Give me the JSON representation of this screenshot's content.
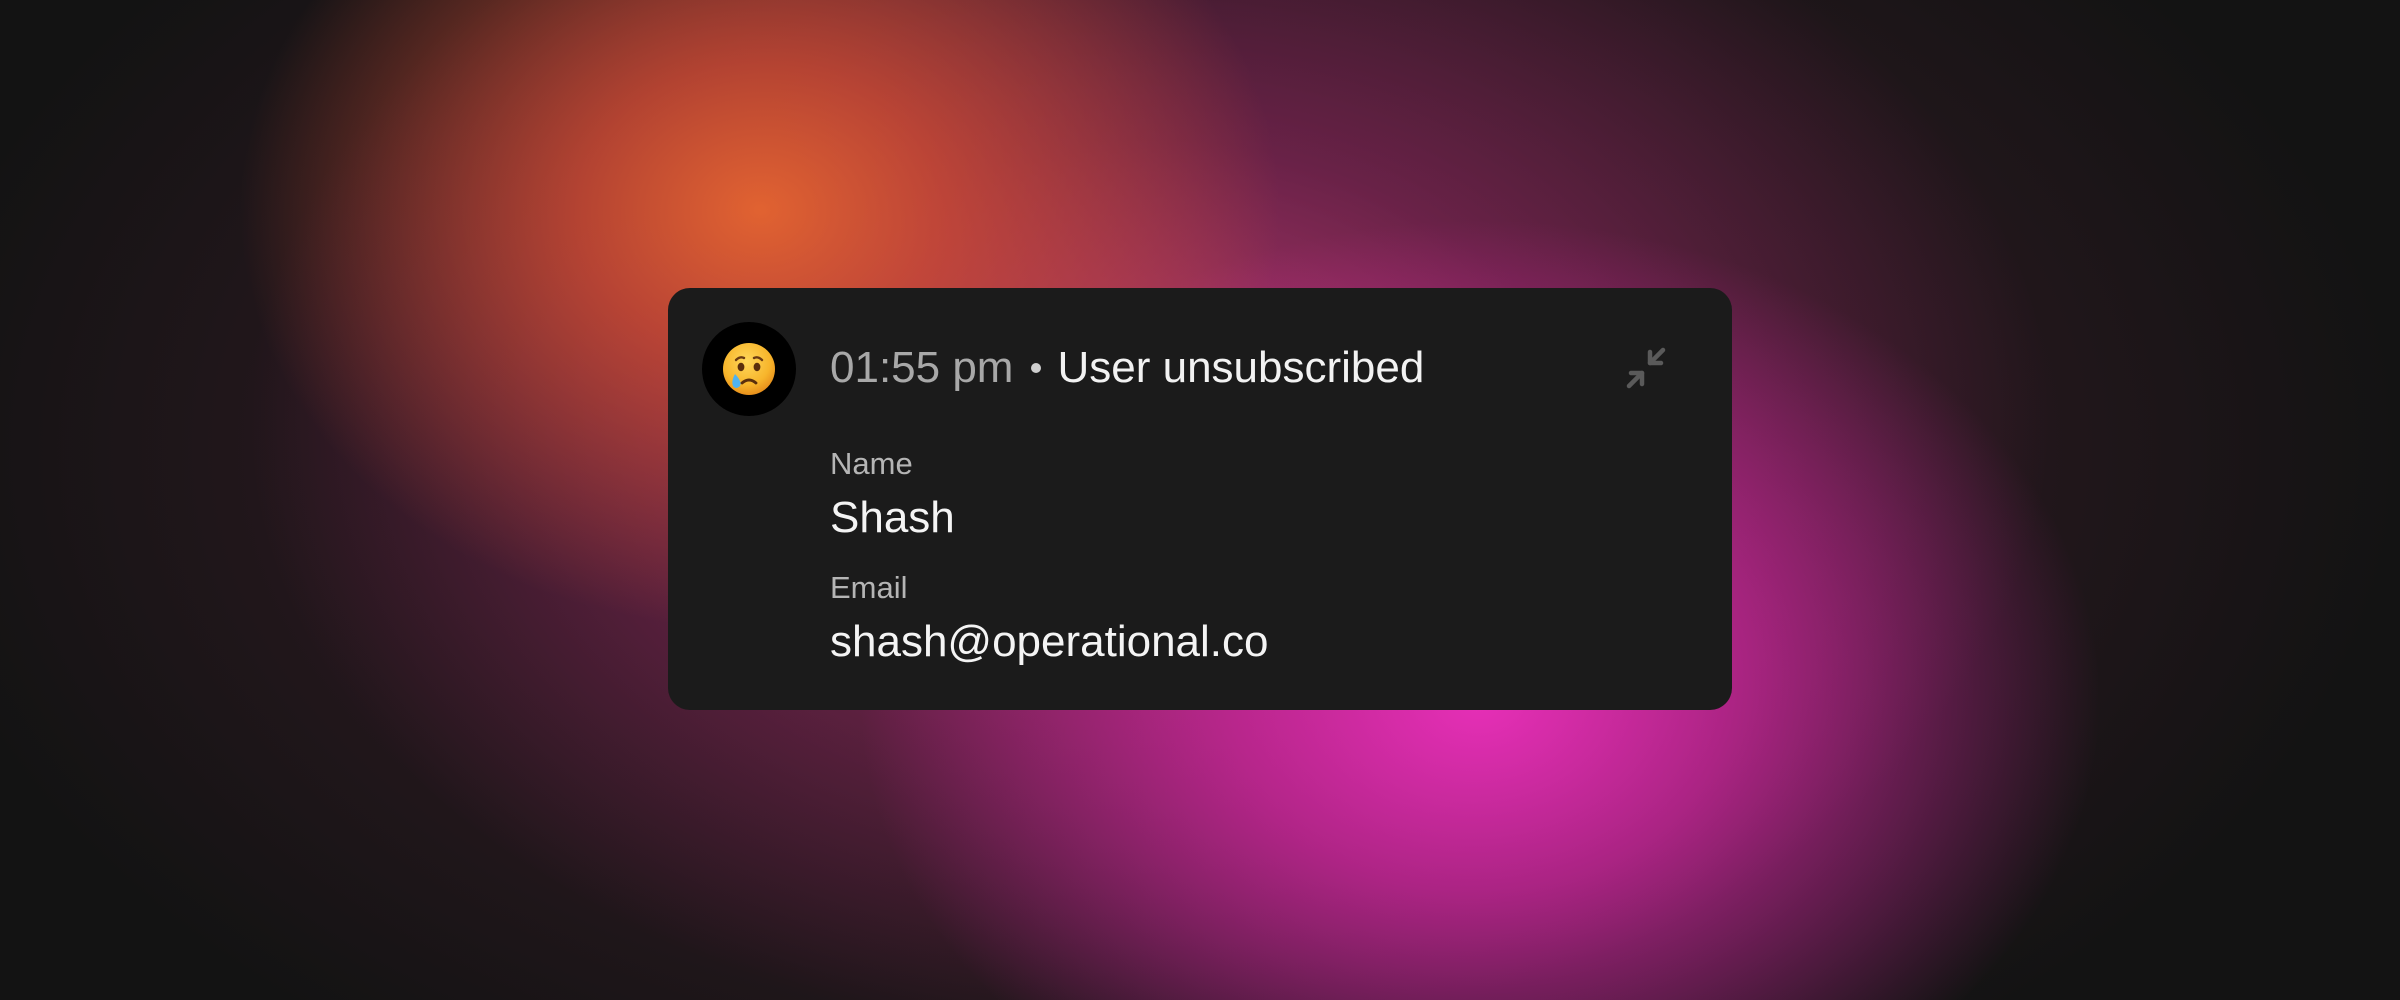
{
  "notification": {
    "avatar_icon": "crying-face-emoji",
    "time": "01:55 pm",
    "separator": "•",
    "event": "User unsubscribed",
    "collapse_icon": "collapse-arrows-icon",
    "fields": [
      {
        "label": "Name",
        "value": "Shash"
      },
      {
        "label": "Email",
        "value": "shash@operational.co"
      }
    ]
  },
  "colors": {
    "card_background": "#1b1b1b",
    "avatar_background": "#000000",
    "time_text": "#a8a8a8",
    "label_text": "#b5b5b5",
    "value_text": "#f4f4f4",
    "icon_muted": "#5a5a5a",
    "glow_orange": "#e86630",
    "glow_pink": "#ee30be"
  }
}
